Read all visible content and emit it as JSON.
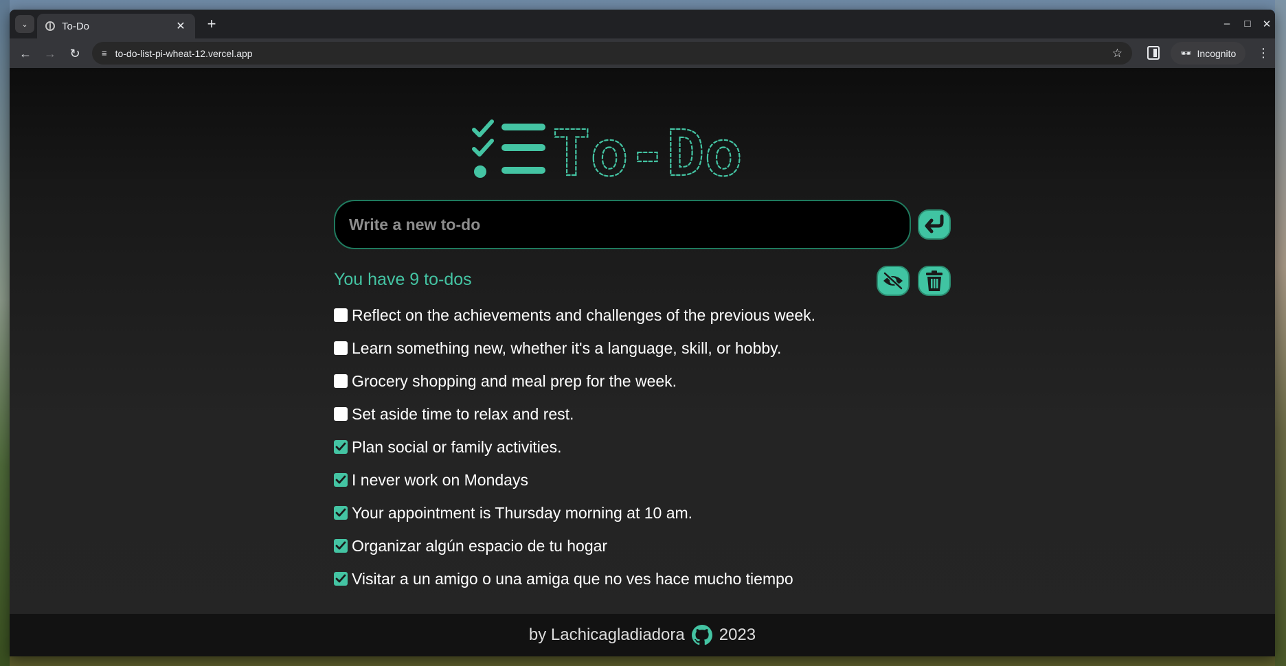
{
  "browser": {
    "tab_title": "To-Do",
    "url": "to-do-list-pi-wheat-12.vercel.app",
    "incognito_label": "Incognito"
  },
  "app": {
    "logo_text": "To-Do",
    "input_placeholder": "Write a new to-do",
    "counter_text": "You have 9 to-dos",
    "todos": [
      {
        "text": "Reflect on the achievements and challenges of the previous week.",
        "completed": false
      },
      {
        "text": "Learn something new, whether it's a language, skill, or hobby.",
        "completed": false
      },
      {
        "text": "Grocery shopping and meal prep for the week.",
        "completed": false
      },
      {
        "text": "Set aside time to relax and rest.",
        "completed": false
      },
      {
        "text": "Plan social or family activities.",
        "completed": true
      },
      {
        "text": "I never work on Mondays",
        "completed": true
      },
      {
        "text": "Your appointment is Thursday morning at 10 am.",
        "completed": true
      },
      {
        "text": "Organizar algún espacio de tu hogar",
        "completed": true
      },
      {
        "text": "Visitar a un amigo o una amiga que no ves hace mucho tiempo",
        "completed": true
      }
    ],
    "footer": {
      "prefix": "by Lachicagladiadora",
      "year": "2023"
    }
  },
  "colors": {
    "accent": "#44c4a3",
    "accent_dark": "#1f7a5e",
    "page_bg": "#242424",
    "footer_bg": "#121212"
  },
  "icons": {
    "submit": "enter-arrow-icon",
    "toggle_visibility": "eye-slash-icon",
    "delete": "trash-icon",
    "footer": "github-icon"
  }
}
